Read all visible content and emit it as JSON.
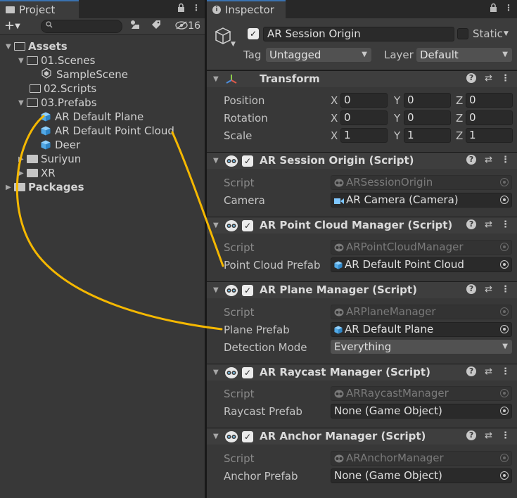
{
  "project": {
    "tab_label": "Project",
    "add_label": "+",
    "hidden_count": "16",
    "tree": [
      {
        "label": "Assets"
      },
      {
        "label": "01.Scenes"
      },
      {
        "label": "SampleScene"
      },
      {
        "label": "02.Scripts"
      },
      {
        "label": "03.Prefabs"
      },
      {
        "label": "AR Default Plane"
      },
      {
        "label": "AR Default Point Cloud"
      },
      {
        "label": "Deer"
      },
      {
        "label": "Suriyun"
      },
      {
        "label": "XR"
      },
      {
        "label": "Packages"
      }
    ]
  },
  "inspector": {
    "tab_label": "Inspector",
    "object_name": "AR Session Origin",
    "static_label": "Static",
    "tag_label": "Tag",
    "tag_value": "Untagged",
    "layer_label": "Layer",
    "layer_value": "Default",
    "transform": {
      "title": "Transform",
      "position_label": "Position",
      "rotation_label": "Rotation",
      "scale_label": "Scale",
      "axis_x": "X",
      "axis_y": "Y",
      "axis_z": "Z",
      "position": [
        "0",
        "0",
        "0"
      ],
      "rotation": [
        "0",
        "0",
        "0"
      ],
      "scale": [
        "1",
        "1",
        "1"
      ]
    },
    "components": [
      {
        "title": "AR Session Origin (Script)",
        "script_label": "Script",
        "script_value": "ARSessionOrigin",
        "field_label": "Camera",
        "field_value": "AR Camera (Camera)"
      },
      {
        "title": "AR Point Cloud Manager (Script)",
        "script_label": "Script",
        "script_value": "ARPointCloudManager",
        "field_label": "Point Cloud Prefab",
        "field_value": "AR Default Point Cloud"
      },
      {
        "title": "AR Plane Manager (Script)",
        "script_label": "Script",
        "script_value": "ARPlaneManager",
        "field_label": "Plane Prefab",
        "field_value": "AR Default Plane",
        "extra_label": "Detection Mode",
        "extra_value": "Everything"
      },
      {
        "title": "AR Raycast Manager (Script)",
        "script_label": "Script",
        "script_value": "ARRaycastManager",
        "field_label": "Raycast Prefab",
        "field_value": "None (Game Object)"
      },
      {
        "title": "AR Anchor Manager (Script)",
        "script_label": "Script",
        "script_value": "ARAnchorManager",
        "field_label": "Anchor Prefab",
        "field_value": "None (Game Object)"
      }
    ]
  },
  "colors": {
    "annotation": "#f5b800",
    "accent": "#3a72b0"
  },
  "icons": [
    "folder-icon",
    "unity-scene-icon",
    "prefab-cube-icon",
    "search-icon",
    "lock-icon",
    "menu-icon",
    "help-icon",
    "preset-icon",
    "script-icon"
  ]
}
